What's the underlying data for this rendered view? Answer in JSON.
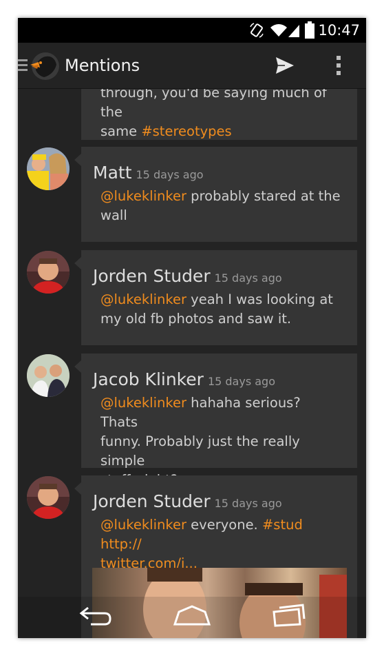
{
  "status_bar": {
    "time": "10:47"
  },
  "action_bar": {
    "title": "Mentions"
  },
  "tweets": [
    {
      "text_lines": [
        {
          "parts": [
            {
              "t": "through, you'd be saying much of the",
              "c": "plain"
            }
          ]
        },
        {
          "parts": [
            {
              "t": "same ",
              "c": "plain"
            },
            {
              "t": "#stereotypes",
              "c": "hash"
            }
          ]
        }
      ]
    },
    {
      "name": "Matt",
      "time": "15 days ago",
      "text_lines": [
        {
          "parts": [
            {
              "t": "@lukeklinker",
              "c": "mention"
            },
            {
              "t": " probably stared at the",
              "c": "plain"
            }
          ]
        },
        {
          "parts": [
            {
              "t": "wall",
              "c": "plain"
            }
          ]
        }
      ]
    },
    {
      "name": "Jorden Studer",
      "time": "15 days ago",
      "text_lines": [
        {
          "parts": [
            {
              "t": "@lukeklinker",
              "c": "mention"
            },
            {
              "t": " yeah I was looking at",
              "c": "plain"
            }
          ]
        },
        {
          "parts": [
            {
              "t": "my old fb photos and saw it.",
              "c": "plain"
            }
          ]
        }
      ]
    },
    {
      "name": "Jacob Klinker",
      "time": "15 days ago",
      "text_lines": [
        {
          "parts": [
            {
              "t": "@lukeklinker",
              "c": "mention"
            },
            {
              "t": " hahaha serious? Thats",
              "c": "plain"
            }
          ]
        },
        {
          "parts": [
            {
              "t": "funny. Probably just the really simple",
              "c": "plain"
            }
          ]
        },
        {
          "parts": [
            {
              "t": "stuff, right?",
              "c": "plain"
            }
          ]
        }
      ]
    },
    {
      "name": "Jorden Studer",
      "time": "15 days ago",
      "text_lines": [
        {
          "parts": [
            {
              "t": "@lukeklinker",
              "c": "mention"
            },
            {
              "t": " everyone. ",
              "c": "plain"
            },
            {
              "t": "#stud",
              "c": "hash"
            },
            {
              "t": " http://",
              "c": "link"
            }
          ]
        },
        {
          "parts": [
            {
              "t": "twitter.com/j...",
              "c": "link"
            }
          ]
        }
      ]
    }
  ],
  "colors": {
    "accent": "#f08c1e",
    "card": "#353535",
    "background": "#232323"
  },
  "icons": [
    "drawer-icon",
    "app-logo-icon",
    "compose-send-icon",
    "overflow-menu-icon",
    "back-icon",
    "home-icon",
    "recents-icon"
  ]
}
